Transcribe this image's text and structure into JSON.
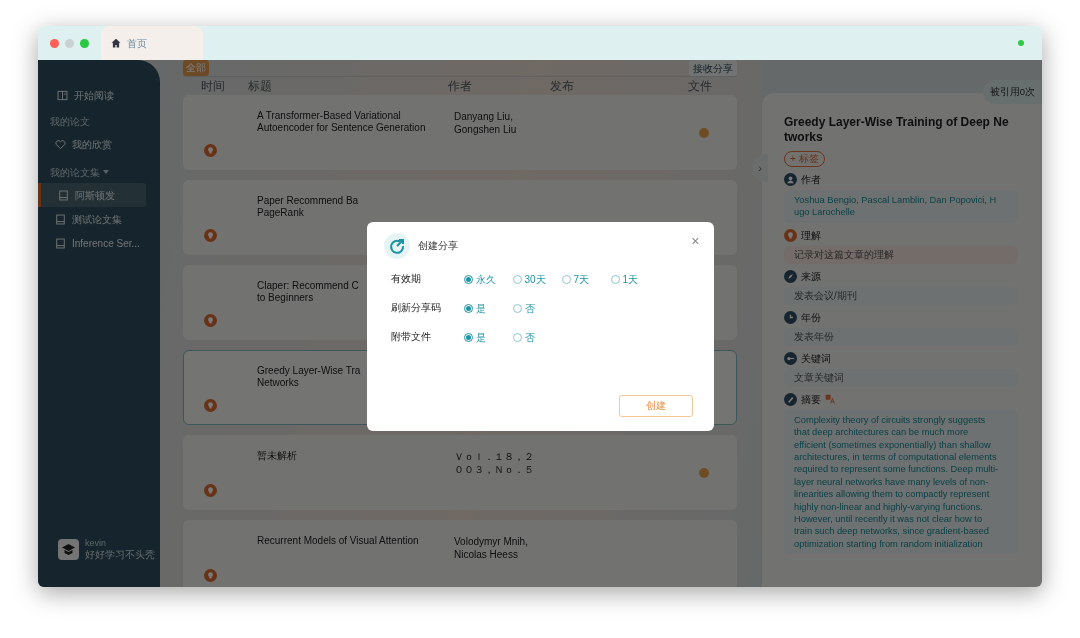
{
  "window": {
    "tab": {
      "label": "首页",
      "selected": true
    }
  },
  "sidebar": {
    "start": {
      "label": "开始阅读"
    },
    "sections": [
      {
        "title": "我的论文",
        "expanded": false,
        "items": [
          {
            "label": "我的欣赏",
            "selected": false
          }
        ]
      },
      {
        "title": "我的论文集",
        "expanded": true,
        "items": [
          {
            "label": "阿斯顿发",
            "selected": true
          },
          {
            "label": "测试论文集",
            "selected": false
          },
          {
            "label": "Inference Ser...",
            "selected": false
          }
        ]
      }
    ],
    "user": {
      "name": "kevin",
      "motto": "好好学习不头秃"
    }
  },
  "toolbar": {
    "filter": "全部",
    "receive_button": "接收分享"
  },
  "table": {
    "columns": [
      "时间",
      "标题",
      "作者",
      "发布",
      "文件"
    ],
    "rows": [
      {
        "title_lines": [
          "A Transformer-Based Variational",
          "Autoencoder for Sentence Generation"
        ],
        "author_lines": [
          "Danyang Liu,",
          "Gongshen Liu"
        ],
        "has_file": true,
        "selected": false
      },
      {
        "title_lines": [
          "Paper Recommend Ba",
          "PageRank"
        ],
        "author_lines": [],
        "has_file": false,
        "selected": false
      },
      {
        "title_lines": [
          "Claper: Recommend C",
          "to Beginners"
        ],
        "author_lines": [],
        "has_file": false,
        "selected": false
      },
      {
        "title_lines": [
          "Greedy Layer-Wise Tra",
          "Networks"
        ],
        "author_lines": [],
        "has_file": false,
        "selected": true
      },
      {
        "title_lines": [
          "暂未解析"
        ],
        "author_lines": [
          "Ｖｏｌ．１８，２",
          "００３，Ｎｏ．５"
        ],
        "has_file": true,
        "selected": false
      },
      {
        "title_lines": [
          "Recurrent Models of Visual Attention"
        ],
        "author_lines": [
          "Volodymyr Mnih,",
          "Nicolas Heess"
        ],
        "has_file": false,
        "selected": false
      }
    ]
  },
  "detail": {
    "citations": "被引用0次",
    "collapse": "›",
    "title_lines": [
      "Greedy Layer-Wise Training of Deep Ne",
      "tworks"
    ],
    "tag_button": "+ 标签",
    "fields": [
      {
        "kind": "author",
        "label": "作者",
        "value_lines": [
          "Yoshua Bengio, Pascal Lamblin, Dan Popovici, H",
          "ugo Larochelle"
        ]
      },
      {
        "kind": "insight",
        "label": "理解",
        "placeholder": "记录对这篇文章的理解"
      },
      {
        "kind": "source",
        "label": "来源",
        "placeholder": "发表会议/期刊"
      },
      {
        "kind": "year",
        "label": "年份",
        "placeholder": "发表年份"
      },
      {
        "kind": "keywords",
        "label": "关键词",
        "placeholder": "文章关键词"
      },
      {
        "kind": "abstract",
        "label": "摘要",
        "value_lines": [
          "Complexity theory of circuits strongly suggests",
          "that deep architectures can be much more",
          "efficient (sometimes exponentially) than shallow",
          "architectures, in terms of computational elements",
          "required to represent some functions. Deep multi-",
          "layer neural networks have many levels of non-",
          "linearities allowing them to compactly represent",
          "highly non-linear and highly-varying functions.",
          "However, until recently it was not clear how to",
          "train such deep networks, since gradient-based",
          "optimization starting from random initialization"
        ]
      }
    ]
  },
  "modal": {
    "title": "创建分享",
    "close": "×",
    "fields": [
      {
        "label": "有效期",
        "options": [
          {
            "label": "永久",
            "selected": true
          },
          {
            "label": "30天",
            "selected": false
          },
          {
            "label": "7天",
            "selected": false
          },
          {
            "label": "1天",
            "selected": false
          }
        ]
      },
      {
        "label": "刷新分享码",
        "options": [
          {
            "label": "是",
            "selected": true
          },
          {
            "label": "否",
            "selected": false
          }
        ]
      },
      {
        "label": "附带文件",
        "options": [
          {
            "label": "是",
            "selected": true
          },
          {
            "label": "否",
            "selected": false
          }
        ]
      }
    ],
    "button": "创建"
  }
}
